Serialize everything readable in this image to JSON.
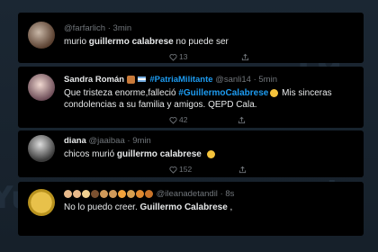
{
  "colors": {
    "accent": "#1d9bf0",
    "card_bg": "#000000",
    "text": "#e7e9ea",
    "muted": "#71767b"
  },
  "tweets": [
    {
      "user": "",
      "handle": "@farfarlich",
      "time": "3min",
      "text_a": "murio ",
      "text_b": "guillermo calabrese",
      "text_c": " no puede ser",
      "likes": "13"
    },
    {
      "user": "Sandra Román",
      "tag_user": "#PatriaMilitante",
      "handle": "@sanli14",
      "time": "5min",
      "text_a": "Que tristeza enorme,falleció ",
      "tag": "#GuillermoCalabrese",
      "text_b": " Mis sinceras",
      "text_c": "condolencias a su familia y amigos. QEPD Cala.",
      "likes": "42"
    },
    {
      "user": "diana",
      "handle": "@jaaibaa",
      "time": "9min",
      "text_a": "chicos murió ",
      "text_b": "guillermo calabrese",
      "likes": "152"
    },
    {
      "handle": "@ileanadetandil",
      "time": "8s",
      "text_a": "No lo puedo creer. ",
      "text_b": "Guillermo Calabrese",
      "text_c": " ,"
    }
  ],
  "icons": [
    "reply-icon",
    "retweet-icon",
    "like-icon",
    "share-icon"
  ]
}
